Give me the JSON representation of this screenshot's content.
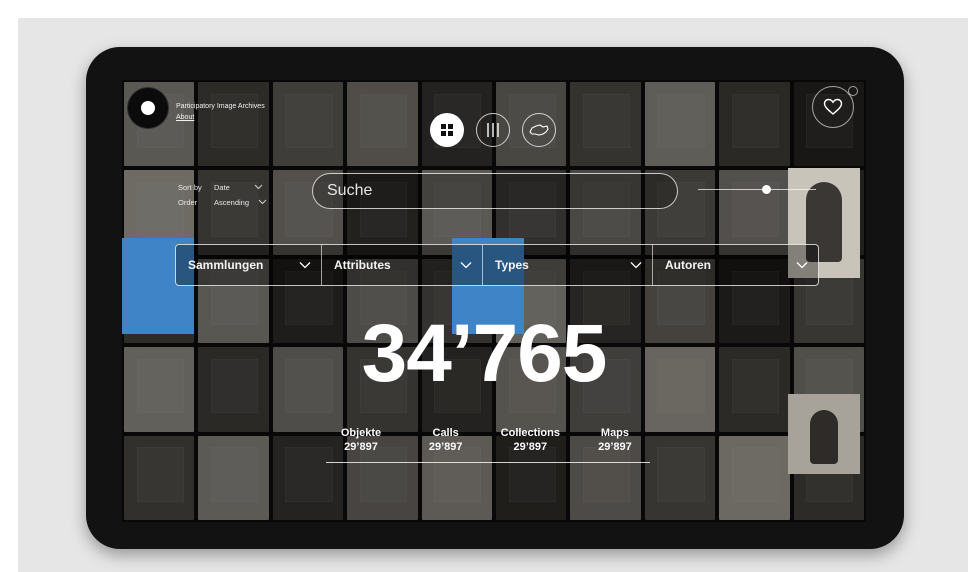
{
  "app": {
    "name": "Participatory Image Archives",
    "about_label": "About"
  },
  "sort": {
    "sort_label": "Sort by",
    "sort_value": "Date",
    "order_label": "Order",
    "order_value": "Ascending"
  },
  "view_modes": [
    {
      "icon": "grid-icon",
      "active": true
    },
    {
      "icon": "timeline-icon",
      "active": false
    },
    {
      "icon": "map-icon",
      "active": false
    }
  ],
  "search": {
    "placeholder": "Suche"
  },
  "filters": [
    {
      "label": "Sammlungen"
    },
    {
      "label": "Attributes"
    },
    {
      "label": "Types"
    },
    {
      "label": "Autoren"
    }
  ],
  "total": {
    "value": "34’765"
  },
  "stats": [
    {
      "label": "Objekte",
      "value": "29’897"
    },
    {
      "label": "Calls",
      "value": "29’897"
    },
    {
      "label": "Collections",
      "value": "29’897"
    },
    {
      "label": "Maps",
      "value": "29’897"
    }
  ],
  "colors": {
    "accent_blue": "#3e84c6",
    "background": "#e6e6e6",
    "tablet": "#121212"
  },
  "icons": {
    "favorites": "heart-icon",
    "chevron": "chevron-down-icon",
    "logo": "logo-icon"
  }
}
